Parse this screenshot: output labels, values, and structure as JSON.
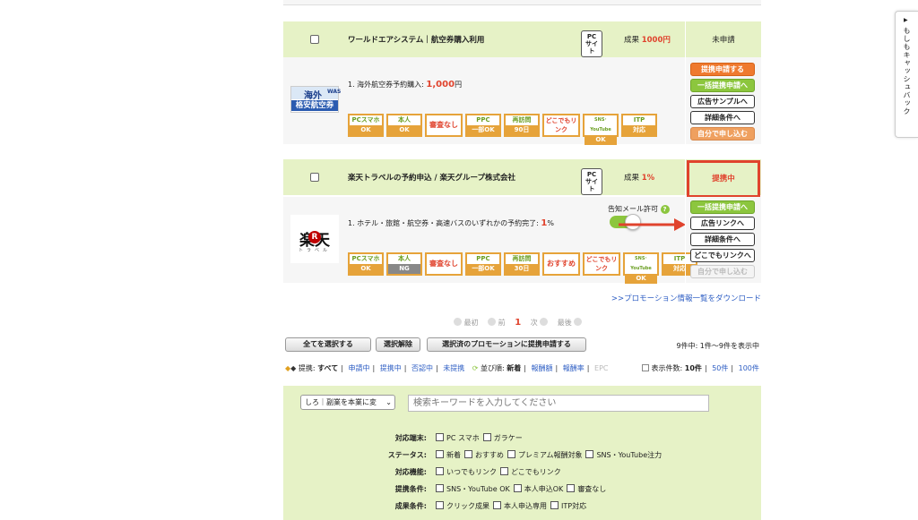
{
  "offers": [
    {
      "title": "ワールドエアシステム｜航空券購入利用",
      "device": "PCサイト",
      "reward_prefix": "成果 ",
      "reward_value": "1000円",
      "status": "未申請",
      "condition_prefix": "1. 海外航空券予約購入:",
      "condition_value": "1,000",
      "condition_unit": "円",
      "logo_line1": "海外",
      "logo_line2": "格安航空券",
      "logo_was": "WAS",
      "tags": [
        {
          "top": "PCスマホ",
          "bottom": "OK"
        },
        {
          "top": "本人",
          "bottom": "OK"
        },
        {
          "single": "審査なし"
        },
        {
          "top": "PPC",
          "bottom": "一部OK"
        },
        {
          "top": "再訪問",
          "bottom": "90日"
        },
        {
          "single": "どこでもリンク"
        },
        {
          "top": "SNS･YouTube",
          "bottom": "OK"
        },
        {
          "top": "ITP",
          "bottom": "対応"
        }
      ],
      "actions": [
        "提携申請する",
        "一括提携申請へ",
        "広告サンプルへ",
        "詳細条件へ",
        "自分で申し込む"
      ]
    },
    {
      "title": "楽天トラベルの予約申込 / 楽天グループ株式会社",
      "device": "PCサイト",
      "reward_prefix": "成果 ",
      "reward_value": "1%",
      "status": "提携中",
      "condition_prefix": "1. ホテル・旅館・航空券・高速バスのいずれかの予約完了:",
      "condition_value": "1",
      "condition_unit": "%",
      "logo_main": "楽天",
      "logo_sub": "トラベル",
      "mail_label": "告知メール許可",
      "mail_help": "?",
      "tags": [
        {
          "top": "PCスマホ",
          "bottom": "OK"
        },
        {
          "top": "本人",
          "bottom": "NG"
        },
        {
          "single": "審査なし"
        },
        {
          "top": "PPC",
          "bottom": "一部OK"
        },
        {
          "top": "再訪問",
          "bottom": "30日"
        },
        {
          "single": "おすすめ"
        },
        {
          "single": "どこでもリンク"
        },
        {
          "top": "SNS･YouTube",
          "bottom": "OK"
        },
        {
          "top": "ITP",
          "bottom": "対応"
        }
      ],
      "actions": [
        "一括提携申請へ",
        "広告リンクへ",
        "詳細条件へ",
        "どこでもリンクへ",
        "自分で申し込む"
      ]
    }
  ],
  "download_link": ">>プロモーション情報一覧をダウンロード",
  "pagination": {
    "first": "最初",
    "prev": "前",
    "current": "1",
    "next": "次",
    "last": "最後"
  },
  "bulk": {
    "select_all": "全てを選択する",
    "deselect": "選択解除",
    "apply_selected": "選択済のプロモーションに提携申請する",
    "count": "9件中: 1件〜9件を表示中"
  },
  "filter_bar": {
    "affiliation_label": "提携:",
    "affiliation": [
      "すべて",
      "申請中",
      "提携中",
      "否認中",
      "未提携"
    ],
    "sort_label": "並び順:",
    "sort": [
      "新着",
      "報酬額",
      "報酬率",
      "EPC"
    ],
    "per_page_label": "表示件数:",
    "per_page": [
      "10件",
      "50件",
      "100件"
    ]
  },
  "search": {
    "category": "しろ｜副業を本業に変",
    "placeholder": "検索キーワードを入力してください",
    "rows": [
      {
        "label": "対応端末:",
        "options": [
          "PC スマホ",
          "ガラケー"
        ]
      },
      {
        "label": "ステータス:",
        "options": [
          "新着",
          "おすすめ",
          "プレミアム報酬対象",
          "SNS・YouTube注力"
        ]
      },
      {
        "label": "対応機能:",
        "options": [
          "いつでもリンク",
          "どこでもリンク"
        ]
      },
      {
        "label": "提携条件:",
        "options": [
          "SNS・YouTube OK",
          "本人申込OK",
          "審査なし"
        ]
      },
      {
        "label": "成果条件:",
        "options": [
          "クリック成果",
          "本人申込専用",
          "ITP対応"
        ]
      }
    ]
  },
  "side_tab": "もしもキャッシュバック",
  "colors": {
    "accent_red": "#e0432d",
    "green": "#8cc63e",
    "orange": "#ef7a2f",
    "row_green": "#e6f2c6"
  }
}
